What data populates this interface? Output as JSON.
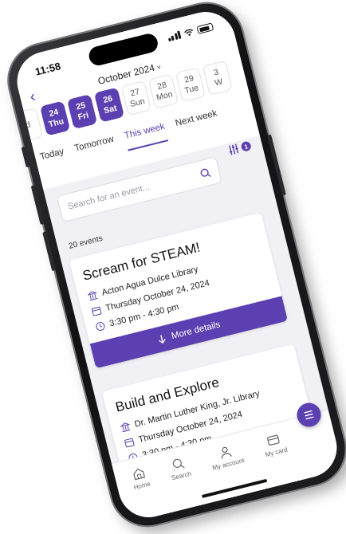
{
  "status": {
    "time": "11:58"
  },
  "header": {
    "month": "October 2024",
    "month_chevron": "chevron-down-icon"
  },
  "dates": [
    {
      "num": "",
      "day": "d",
      "selected": false
    },
    {
      "num": "24",
      "day": "Thu",
      "selected": true
    },
    {
      "num": "25",
      "day": "Fri",
      "selected": true
    },
    {
      "num": "26",
      "day": "Sat",
      "selected": true
    },
    {
      "num": "27",
      "day": "Sun",
      "selected": false
    },
    {
      "num": "28",
      "day": "Mon",
      "selected": false
    },
    {
      "num": "29",
      "day": "Tue",
      "selected": false
    },
    {
      "num": "3",
      "day": "W",
      "selected": false
    }
  ],
  "tabs": [
    "Today",
    "Tomorrow",
    "This week",
    "Next week"
  ],
  "active_tab": "This week",
  "filter": {
    "badge": "1"
  },
  "search": {
    "placeholder": "Search for an event..."
  },
  "results": {
    "count": "20 events"
  },
  "events": [
    {
      "title": "Scream for STEAM!",
      "location": "Acton Agua Dulce Library",
      "date": "Thursday October 24, 2024",
      "time": "3:30 pm - 4:30 pm",
      "button": "More details"
    },
    {
      "title": "Build and Explore",
      "location": "Dr. Martin Luther King, Jr. Library",
      "date": "Thursday October 24, 2024",
      "time": "3:30 pm - 4:30 pm"
    }
  ],
  "nav": [
    {
      "label": "Home",
      "icon": "home-icon"
    },
    {
      "label": "Search",
      "icon": "search-icon"
    },
    {
      "label": "My account",
      "icon": "user-icon"
    },
    {
      "label": "My card",
      "icon": "card-icon"
    }
  ],
  "colors": {
    "accent": "#5c3fb0",
    "background": "#f1f0f5"
  }
}
